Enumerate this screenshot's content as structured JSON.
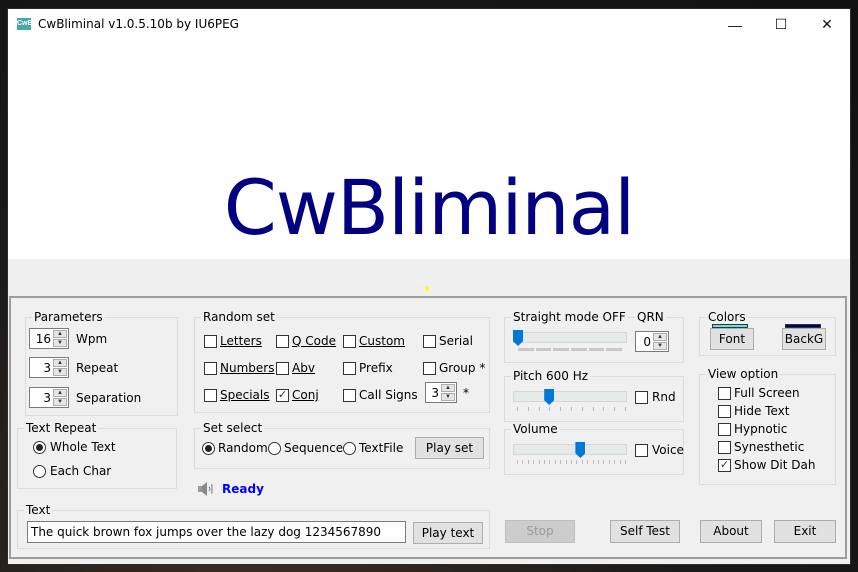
{
  "window": {
    "title": "CwBliminal v1.0.5.10b by IU6PEG",
    "app_icon_text": "CwB",
    "controls": {
      "minimize": "—",
      "maximize": "☐",
      "close": "✕"
    }
  },
  "display": {
    "big_text": "CwBliminal",
    "big_text_color": "#000080",
    "morse_dot_color": "#ffff00"
  },
  "parameters": {
    "label": "Parameters",
    "wpm": {
      "value": "16",
      "label": "Wpm"
    },
    "repeat": {
      "value": "3",
      "label": "Repeat"
    },
    "separation": {
      "value": "3",
      "label": "Separation"
    }
  },
  "random_set": {
    "label": "Random set",
    "items": [
      {
        "label": "Letters",
        "checked": false
      },
      {
        "label": "Q Code",
        "checked": false
      },
      {
        "label": "Custom",
        "checked": false
      },
      {
        "label": "Serial",
        "checked": false
      },
      {
        "label": "Numbers",
        "checked": false
      },
      {
        "label": "Abv",
        "checked": false
      },
      {
        "label": "Prefix",
        "checked": false
      },
      {
        "label": "Group *",
        "checked": false
      },
      {
        "label": "Specials",
        "checked": false
      },
      {
        "label": "Conj",
        "checked": true
      },
      {
        "label": "Call Signs",
        "checked": false
      }
    ],
    "group_size": {
      "value": "3",
      "suffix": "*"
    }
  },
  "straight": {
    "label": "Straight mode OFF",
    "slider_value_fraction": 0.0,
    "qrn_label": "QRN",
    "qrn_value": "0"
  },
  "pitch": {
    "label": "Pitch 600 Hz",
    "slider_value_fraction": 0.3,
    "rnd_label": "Rnd",
    "rnd_checked": false
  },
  "volume": {
    "label": "Volume",
    "slider_value_fraction": 0.6,
    "voice_label": "Voice",
    "voice_checked": false
  },
  "colors": {
    "label": "Colors",
    "font_button": "Font",
    "font_color": "#55e8e8",
    "backg_button": "BackG",
    "backg_color": "#000066"
  },
  "view_option": {
    "label": "View option",
    "items": [
      {
        "label": "Full Screen",
        "checked": false
      },
      {
        "label": "Hide Text",
        "checked": false
      },
      {
        "label": "Hypnotic",
        "checked": false
      },
      {
        "label": "Synesthetic",
        "checked": false
      },
      {
        "label": "Show Dit Dah",
        "checked": true
      }
    ]
  },
  "text_repeat": {
    "label": "Text Repeat",
    "options": [
      {
        "label": "Whole Text",
        "selected": true
      },
      {
        "label": "Each Char",
        "selected": false
      }
    ]
  },
  "set_select": {
    "label": "Set select",
    "options": [
      {
        "label": "Random",
        "selected": true
      },
      {
        "label": "Sequences",
        "selected": false
      },
      {
        "label": "TextFile",
        "selected": false
      }
    ],
    "play_button": "Play set"
  },
  "status": {
    "text": "Ready",
    "icon": "speaker-icon"
  },
  "text_group": {
    "label": "Text",
    "value": "The quick brown fox jumps over the lazy dog 1234567890",
    "play_button": "Play text"
  },
  "buttons": {
    "stop": "Stop",
    "self_test": "Self Test",
    "about": "About",
    "exit": "Exit"
  }
}
